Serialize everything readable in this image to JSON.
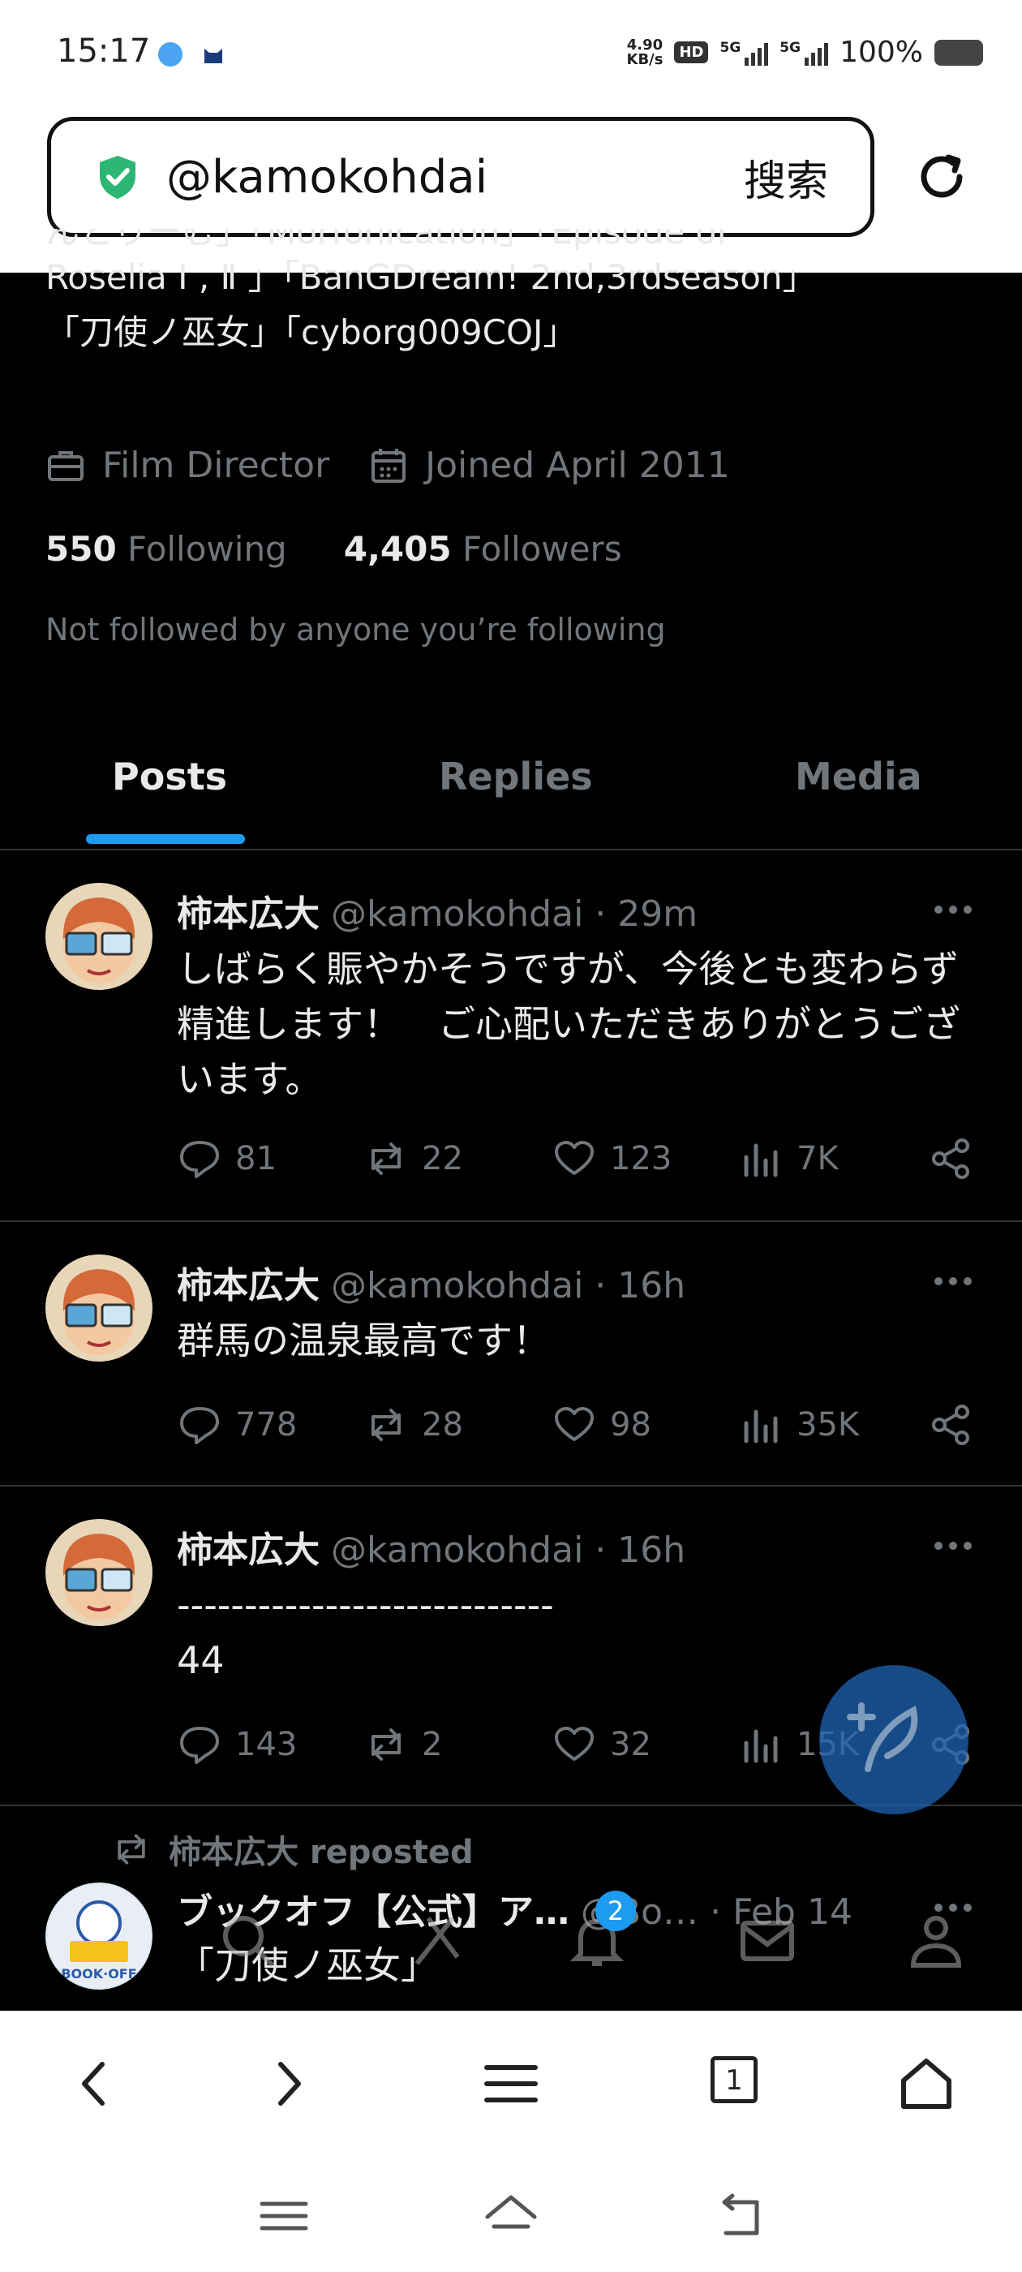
{
  "status_bar": {
    "time": "15:17",
    "net_speed_top": "4.90",
    "net_speed_unit": "KB/s",
    "hd_label": "HD",
    "sig1_label": "5G",
    "sig2_label": "5G",
    "battery": "100%"
  },
  "browser": {
    "url": "@kamokohdai",
    "search_label": "搜索",
    "tab_count": "1"
  },
  "profile": {
    "bio_clipped_line": "んとりーむ」「Morfonication」「Episode of",
    "bio_line_1": "Roselia Ⅰ , Ⅱ 」「BanGDream! 2nd,3rdseason」",
    "bio_line_2": "「刀使ノ巫女」「cyborg009COJ」",
    "profession": "Film Director",
    "joined": "Joined April 2011",
    "following_count": "550",
    "following_label": "Following",
    "followers_count": "4,405",
    "followers_label": "Followers",
    "not_followed": "Not followed by anyone you’re following"
  },
  "tabs": [
    {
      "label": "Posts",
      "active": true
    },
    {
      "label": "Replies",
      "active": false
    },
    {
      "label": "Media",
      "active": false
    }
  ],
  "posts": [
    {
      "name": "柿本広大",
      "handle": "@kamokohdai · 29m",
      "text": "しばらく賑やかそうですが、今後とも変わらず精進します！　ご心配いただきありがとうございます。",
      "replies": "81",
      "reposts": "22",
      "likes": "123",
      "views": "7K"
    },
    {
      "name": "柿本広大",
      "handle": "@kamokohdai · 16h",
      "text": "群馬の温泉最高です！",
      "replies": "778",
      "reposts": "28",
      "likes": "98",
      "views": "35K"
    },
    {
      "name": "柿本広大",
      "handle": "@kamokohdai · 16h",
      "text": "----------------------------\n44",
      "replies": "143",
      "reposts": "2",
      "likes": "32",
      "views": "15K"
    }
  ],
  "repost": {
    "label": "柿本広大 reposted",
    "name": "ブックオフ【公式】ア…",
    "handle": "@Bo… · Feb 14",
    "text": "「刀使ノ巫女」",
    "avatar_text": "BOOK·OFF"
  },
  "x_nav_badge": "2",
  "colors": {
    "accent": "#1d9bf0",
    "muted": "#71767b",
    "text": "#e7e9ea",
    "divider": "#2f3336",
    "shield": "#2bb673"
  }
}
